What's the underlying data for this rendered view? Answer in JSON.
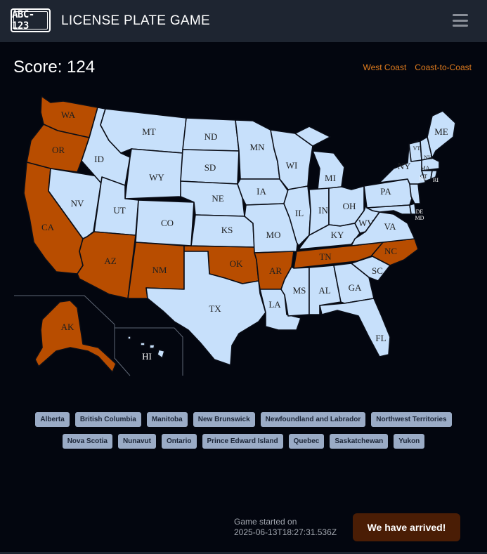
{
  "header": {
    "logo_text": "ABC-123",
    "title": "LICENSE PLATE GAME",
    "menu_icon": "hamburger-menu-icon"
  },
  "score_text": "Score: 124",
  "filters": [
    "West Coast",
    "Coast-to-Coast"
  ],
  "colors": {
    "visited": "#b84d00",
    "unvisited": "#c7e0fb",
    "filter_link": "#e17c1e",
    "chip": "#9aabc6",
    "arrive_button": "#4a1d05"
  },
  "map": {
    "visited_states": [
      "WA",
      "OR",
      "CA",
      "AZ",
      "NM",
      "OK",
      "AR",
      "TN",
      "NC",
      "AK"
    ],
    "labels": {
      "WA": "WA",
      "OR": "OR",
      "CA": "CA",
      "NV": "NV",
      "ID": "ID",
      "MT": "MT",
      "WY": "WY",
      "UT": "UT",
      "AZ": "AZ",
      "CO": "CO",
      "NM": "NM",
      "ND": "ND",
      "SD": "SD",
      "NE": "NE",
      "KS": "KS",
      "OK": "OK",
      "TX": "TX",
      "MN": "MN",
      "IA": "IA",
      "MO": "MO",
      "AR": "AR",
      "LA": "LA",
      "WI": "WI",
      "IL": "IL",
      "MI": "MI",
      "IN": "IN",
      "OH": "OH",
      "KY": "KY",
      "TN": "TN",
      "MS": "MS",
      "AL": "AL",
      "GA": "GA",
      "FL": "FL",
      "SC": "SC",
      "NC": "NC",
      "VA": "VA",
      "WV": "WV",
      "PA": "PA",
      "NY": "NY",
      "VT": "VT",
      "NH": "NH",
      "ME": "ME",
      "MA": "MA",
      "CT": "CT",
      "RI": "RI",
      "NJ": "NJ",
      "DE": "DE",
      "MD": "MD",
      "AK": "AK",
      "HI": "HI"
    }
  },
  "provinces": [
    "Alberta",
    "British Columbia",
    "Manitoba",
    "New Brunswick",
    "Newfoundland and Labrador",
    "Northwest Territories",
    "Nova Scotia",
    "Nunavut",
    "Ontario",
    "Prince Edward Island",
    "Quebec",
    "Saskatchewan",
    "Yukon"
  ],
  "footer": {
    "started_label": "Game started on",
    "started_time": "2025-06-13T18:27:31.536Z",
    "arrive_button": "We have arrived!"
  }
}
